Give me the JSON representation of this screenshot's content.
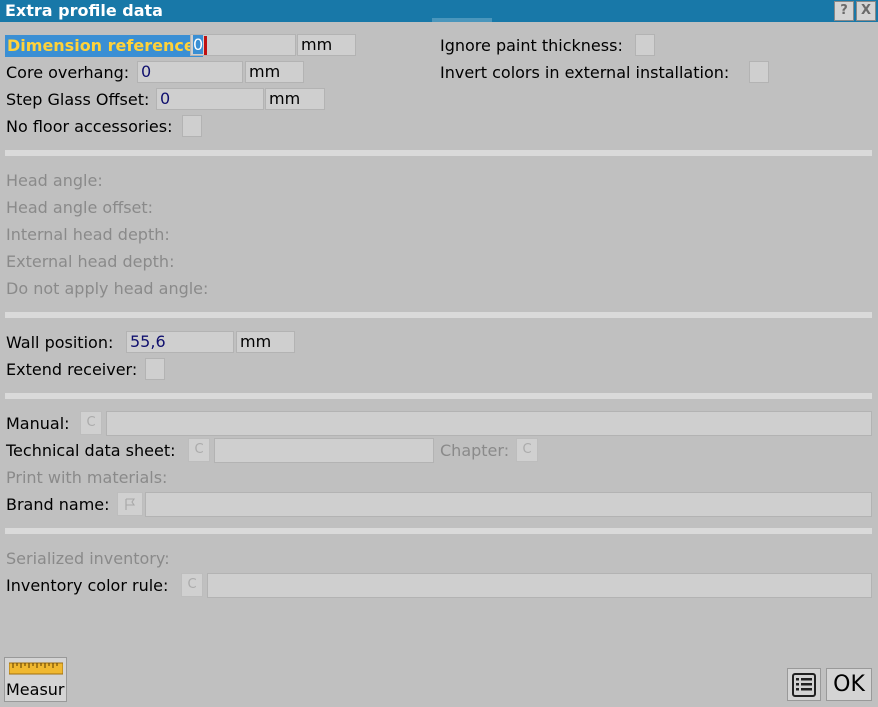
{
  "window": {
    "title": "Extra profile data",
    "help_label": "?",
    "close_label": "X"
  },
  "section1": {
    "dimension_reference": {
      "label": "Dimension reference:",
      "value": "0",
      "unit": "mm"
    },
    "core_overhang": {
      "label": "Core overhang:",
      "value": "0",
      "unit": "mm"
    },
    "step_glass_offset": {
      "label": "Step Glass Offset:",
      "value": "0",
      "unit": "mm"
    },
    "no_floor_accessories": {
      "label": "No floor accessories:"
    },
    "ignore_paint_thickness": {
      "label": "Ignore paint thickness:"
    },
    "invert_colors": {
      "label": "Invert colors in external installation:"
    }
  },
  "section2": {
    "head_angle": "Head angle:",
    "head_angle_offset": "Head angle offset:",
    "internal_head_depth": "Internal head depth:",
    "external_head_depth": "External head depth:",
    "do_not_apply_head_angle": "Do not apply head angle:"
  },
  "section3": {
    "wall_position": {
      "label": "Wall position:",
      "value": "55,6",
      "unit": "mm"
    },
    "extend_receiver": {
      "label": "Extend receiver:"
    }
  },
  "section4": {
    "manual": {
      "label": "Manual:",
      "button": "C",
      "value": ""
    },
    "technical_data_sheet": {
      "label": "Technical data sheet:",
      "button": "C",
      "value": ""
    },
    "chapter": {
      "label": "Chapter:",
      "button": "C"
    },
    "print_with_materials": {
      "label": "Print with materials:"
    },
    "brand_name": {
      "label": "Brand name:",
      "value": ""
    }
  },
  "section5": {
    "serialized_inventory": {
      "label": "Serialized inventory:"
    },
    "inventory_color_rule": {
      "label": "Inventory color rule:",
      "button": "C",
      "value": ""
    }
  },
  "footer": {
    "measure_label": "Measur",
    "ok_label": "OK"
  },
  "icons": {
    "measure": "ruler-icon",
    "list": "list-icon",
    "brand": "flag-icon"
  },
  "colors": {
    "titlebar": "#1878a8",
    "focus": "#3a8fd4",
    "focus_text": "#ffd23a",
    "value_text": "#10106e",
    "background": "#c0c0c0"
  }
}
